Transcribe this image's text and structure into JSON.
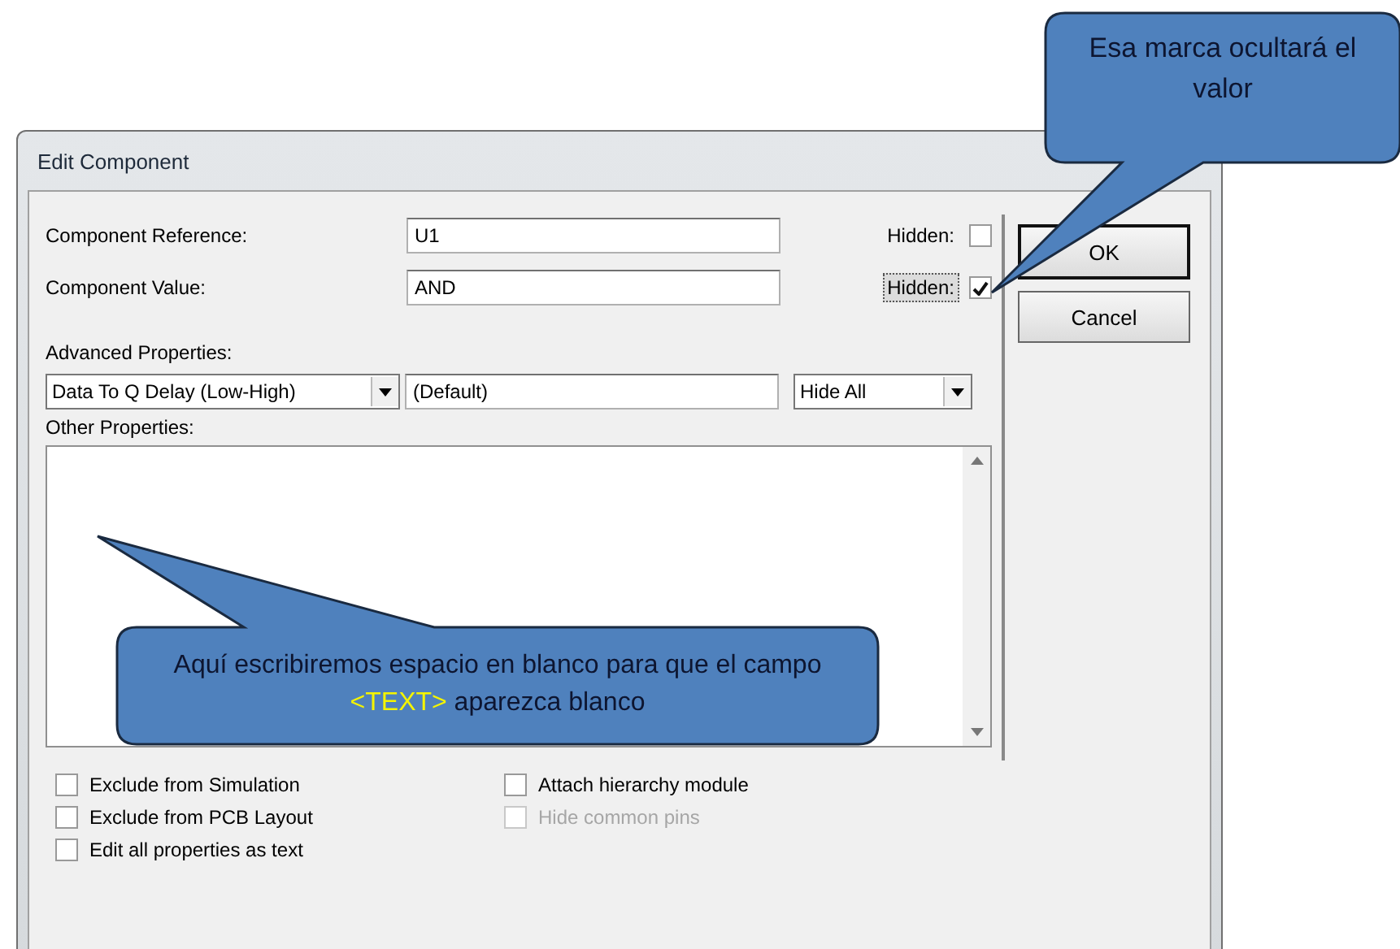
{
  "window": {
    "title": "Edit Component"
  },
  "fields": [
    {
      "label": "Component Reference:",
      "value": "U1",
      "hidden_label": "Hidden:",
      "hidden": false,
      "focused": false
    },
    {
      "label": "Component Value:",
      "value": "AND",
      "hidden_label": "Hidden:",
      "hidden": true,
      "focused": true
    }
  ],
  "advanced": {
    "label": "Advanced Properties:",
    "property": "Data To Q Delay (Low-High)",
    "value": "(Default)",
    "visibility": "Hide All"
  },
  "other": {
    "label": "Other Properties:"
  },
  "options": [
    {
      "label": "Exclude from Simulation",
      "checked": false,
      "disabled": false
    },
    {
      "label": "Attach hierarchy module",
      "checked": false,
      "disabled": false
    },
    {
      "label": "Exclude from PCB Layout",
      "checked": false,
      "disabled": false
    },
    {
      "label": "Hide common pins",
      "checked": false,
      "disabled": true
    },
    {
      "label": "Edit all properties as text",
      "checked": false,
      "disabled": false
    }
  ],
  "buttons": [
    {
      "label": "OK",
      "default": true
    },
    {
      "label": "Cancel",
      "default": false
    }
  ],
  "callouts": [
    {
      "segments": [
        {
          "text": "Esa marca ocultará el valor",
          "highlight": false
        }
      ]
    },
    {
      "segments": [
        {
          "text": "Aquí escribiremos espacio en blanco para que el campo ",
          "highlight": false
        },
        {
          "text": "<TEXT>",
          "highlight": true
        },
        {
          "text": " aparezca blanco",
          "highlight": false
        }
      ]
    }
  ]
}
